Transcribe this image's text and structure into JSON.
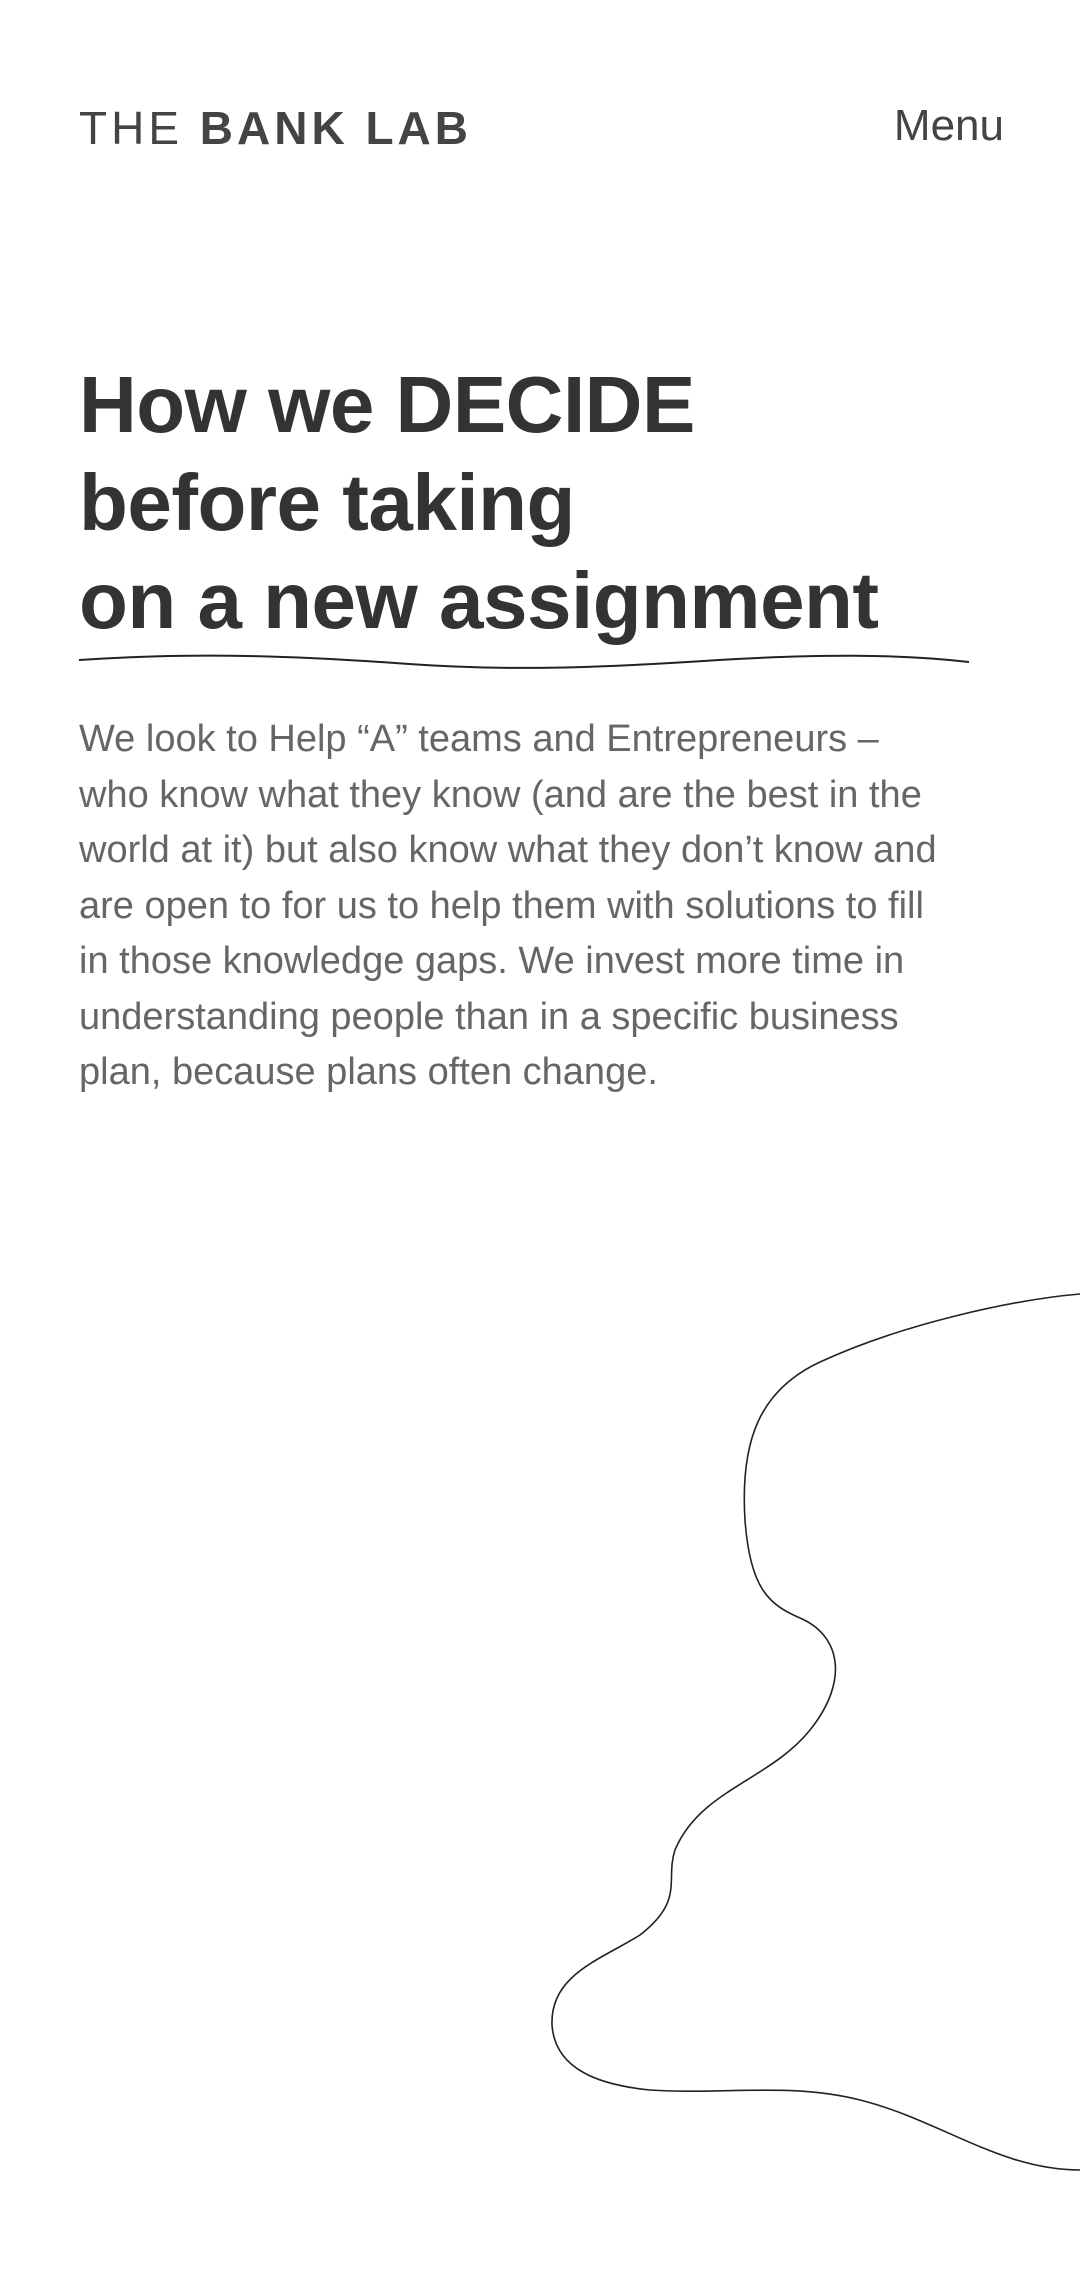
{
  "header": {
    "logo_light": "THE",
    "logo_bold": "BANK LAB",
    "menu_label": "Menu"
  },
  "hero": {
    "title_lines": [
      "How we DECIDE",
      "before taking",
      "on a new assignment"
    ],
    "body": "We look to Help “A” teams and Entrepreneurs –who know what they know (and are the best in the world at it) but also know what they don’t know and are open to for us to help them with solutions to fill in those knowledge gaps. We invest more time in understanding people than in a specific business plan, because plans often change."
  },
  "colors": {
    "text_dark": "#333333",
    "text_body": "#666666",
    "line": "#222222",
    "background": "#ffffff"
  }
}
